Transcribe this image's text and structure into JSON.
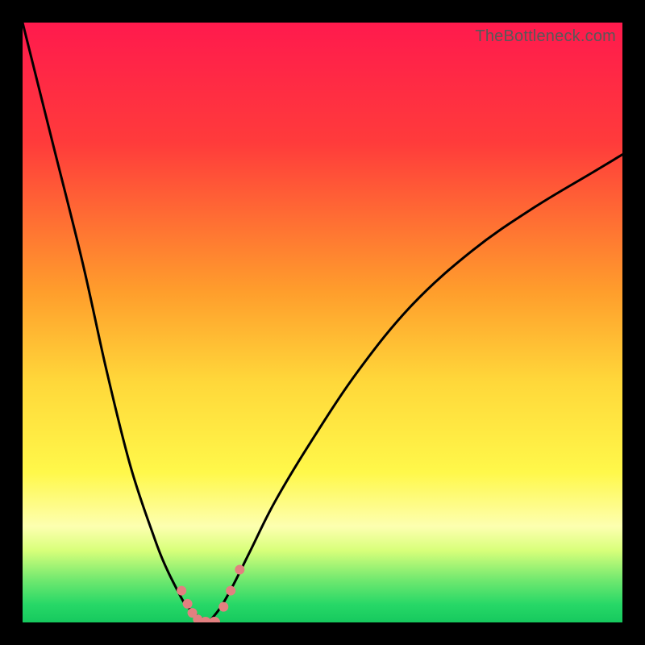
{
  "watermark": "TheBottleneck.com",
  "chart_data": {
    "type": "line",
    "title": "",
    "xlabel": "",
    "ylabel": "",
    "xlim": [
      0,
      100
    ],
    "ylim": [
      0,
      100
    ],
    "gradient_stops": [
      {
        "offset": 0,
        "color": "#ff1a4d"
      },
      {
        "offset": 20,
        "color": "#ff3b3b"
      },
      {
        "offset": 45,
        "color": "#ff9e2c"
      },
      {
        "offset": 60,
        "color": "#ffd83a"
      },
      {
        "offset": 75,
        "color": "#fff84a"
      },
      {
        "offset": 84,
        "color": "#fdffb0"
      },
      {
        "offset": 88,
        "color": "#d8ff7a"
      },
      {
        "offset": 93,
        "color": "#6fe86f"
      },
      {
        "offset": 97,
        "color": "#27d867"
      },
      {
        "offset": 100,
        "color": "#16c95e"
      }
    ],
    "series": [
      {
        "name": "curve-left",
        "x": [
          0,
          5,
          10,
          14,
          18,
          22,
          24,
          26,
          27,
          28,
          29,
          30,
          31
        ],
        "y": [
          100,
          80,
          60,
          42,
          26,
          14,
          9,
          5,
          3.2,
          2.1,
          1.2,
          0.6,
          0
        ]
      },
      {
        "name": "curve-right",
        "x": [
          31,
          33,
          35,
          38,
          42,
          48,
          56,
          65,
          75,
          85,
          95,
          100
        ],
        "y": [
          0,
          2.5,
          6,
          12,
          20,
          30,
          42,
          53,
          62,
          69,
          75,
          78
        ]
      }
    ],
    "markers": {
      "name": "bottleneck-markers",
      "color": "#e38080",
      "points": [
        {
          "x": 26.5,
          "y": 5.3,
          "r": 6
        },
        {
          "x": 27.5,
          "y": 3.1,
          "r": 6
        },
        {
          "x": 28.3,
          "y": 1.6,
          "r": 6
        },
        {
          "x": 29.2,
          "y": 0.5,
          "r": 6
        },
        {
          "x": 30.5,
          "y": 0.0,
          "r": 7
        },
        {
          "x": 32.0,
          "y": 0.0,
          "r": 7
        },
        {
          "x": 33.5,
          "y": 2.6,
          "r": 6
        },
        {
          "x": 34.7,
          "y": 5.3,
          "r": 6
        },
        {
          "x": 36.2,
          "y": 8.8,
          "r": 6
        }
      ]
    }
  }
}
